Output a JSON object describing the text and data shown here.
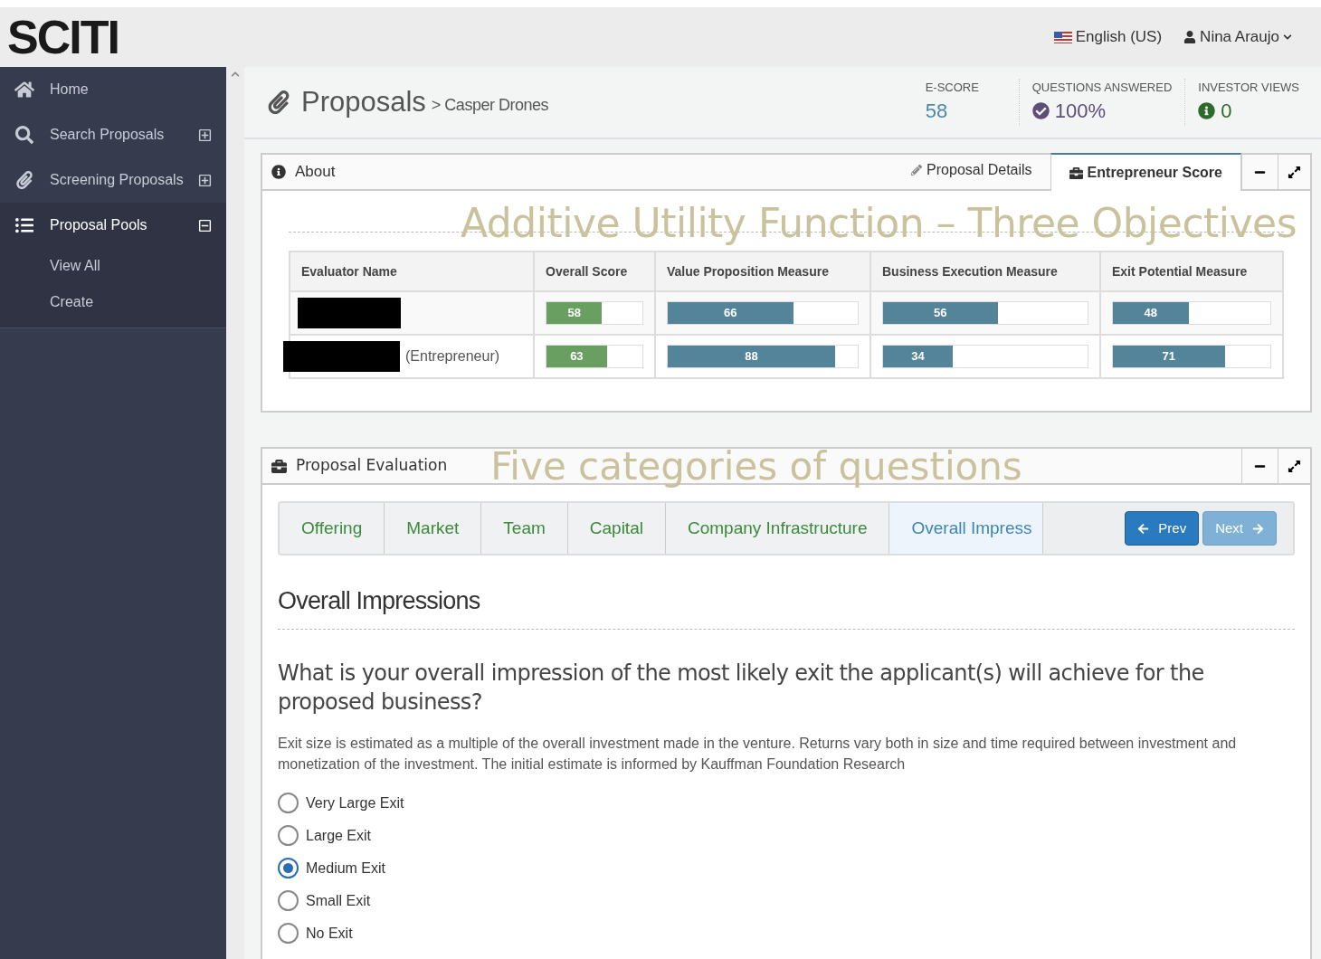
{
  "header": {
    "logo": "SCITI",
    "language": "English (US)",
    "user": "Nina Araujo"
  },
  "sidebar": {
    "items": [
      {
        "label": "Home",
        "selected": false
      },
      {
        "label": "Search Proposals",
        "expanded": false,
        "selected": false
      },
      {
        "label": "Screening Proposals",
        "expanded": false,
        "selected": false
      },
      {
        "label": "Proposal Pools",
        "expanded": true,
        "selected": true,
        "children": [
          {
            "label": "View All"
          },
          {
            "label": "Create"
          }
        ]
      }
    ]
  },
  "page": {
    "title": "Proposals",
    "breadcrumb": "> Casper Drones",
    "stats": [
      {
        "label": "E-SCORE",
        "value": "58"
      },
      {
        "label": "QUESTIONS ANSWERED",
        "value": "100%"
      },
      {
        "label": "INVESTOR VIEWS",
        "value": "0"
      }
    ]
  },
  "about_panel": {
    "title": "About",
    "tabs": [
      {
        "label": "Proposal Details",
        "selected": false
      },
      {
        "label": "Entrepreneur Score",
        "selected": true
      }
    ],
    "overlay_title": "Additive Utility Function – Three Objectives",
    "table": {
      "columns": [
        "Evaluator Name",
        "Overall Score",
        "Value Proposition Measure",
        "Business Execution Measure",
        "Exit Potential Measure"
      ],
      "rows": [
        {
          "name": "",
          "redacted": true,
          "scores": [
            {
              "value": "58",
              "level": 0.58,
              "kind": "overall"
            },
            {
              "value": "66",
              "level": 0.66,
              "kind": "measure"
            },
            {
              "value": "56",
              "level": 0.56,
              "kind": "measure"
            },
            {
              "value": "48",
              "level": 0.48,
              "kind": "measure"
            }
          ]
        },
        {
          "name": "(Entrepreneur)",
          "redacted": true,
          "scores": [
            {
              "value": "63",
              "level": 0.63,
              "kind": "overall"
            },
            {
              "value": "88",
              "level": 0.88,
              "kind": "measure"
            },
            {
              "value": "34",
              "level": 0.34,
              "kind": "measure"
            },
            {
              "value": "71",
              "level": 0.71,
              "kind": "measure"
            }
          ]
        }
      ]
    }
  },
  "evaluation_panel": {
    "title": "Proposal Evaluation",
    "overlay_title": "Five categories of questions",
    "steps": [
      {
        "label": "Offering",
        "selected": false
      },
      {
        "label": "Market",
        "selected": false
      },
      {
        "label": "Team",
        "selected": false
      },
      {
        "label": "Capital",
        "selected": false
      },
      {
        "label": "Company Infrastructure",
        "selected": false
      },
      {
        "label": "Overall Impress",
        "selected": true
      }
    ],
    "prev": {
      "label": "Prev",
      "disabled": false
    },
    "next": {
      "label": "Next",
      "disabled": true
    },
    "section_title": "Overall Impressions",
    "question": "What is your overall impression of the most likely exit the applicant(s) will achieve for the proposed business?",
    "help": "Exit size is estimated as a multiple of the overall investment made in the venture. Returns vary both in size and time required between investment and monetization of the investment. The initial estimate is informed by Kauffman Foundation Research",
    "options": [
      {
        "label": "Very Large Exit",
        "selected": false
      },
      {
        "label": "Large Exit",
        "selected": false
      },
      {
        "label": "Medium Exit",
        "selected": true
      },
      {
        "label": "Small Exit",
        "selected": false
      },
      {
        "label": "No Exit",
        "selected": false
      }
    ]
  }
}
